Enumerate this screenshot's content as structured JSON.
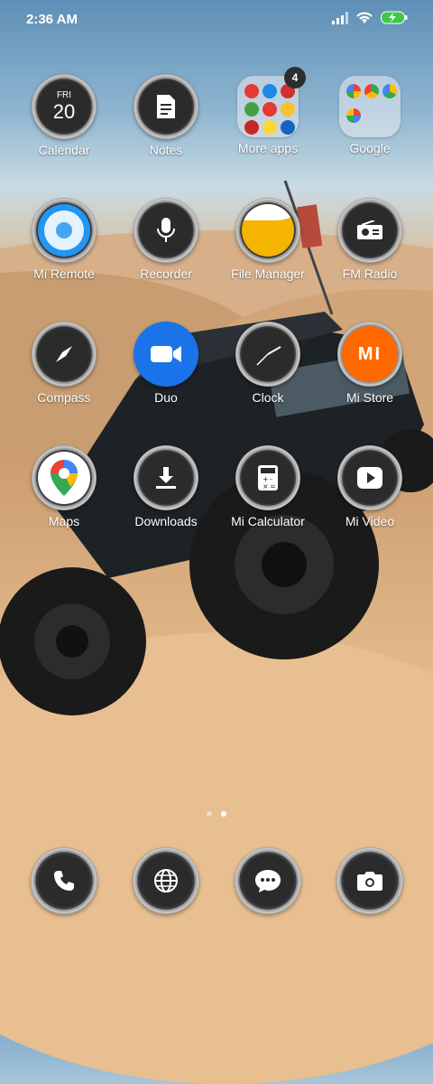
{
  "status": {
    "time": "2:36 AM"
  },
  "rows": [
    [
      {
        "label": "Calendar",
        "day": "FRI",
        "date": "20",
        "icon": "calendar-icon"
      },
      {
        "label": "Notes",
        "icon": "notes-icon"
      },
      {
        "label": "More apps",
        "badge": "4",
        "icon": "folder-icon"
      },
      {
        "label": "Google",
        "icon": "folder-icon"
      }
    ],
    [
      {
        "label": "Mi Remote",
        "icon": "remote-icon"
      },
      {
        "label": "Recorder",
        "icon": "microphone-icon"
      },
      {
        "label": "File Manager",
        "icon": "folder-yellow-icon"
      },
      {
        "label": "FM Radio",
        "icon": "radio-icon"
      }
    ],
    [
      {
        "label": "Compass",
        "icon": "compass-icon"
      },
      {
        "label": "Duo",
        "icon": "video-camera-icon"
      },
      {
        "label": "Clock",
        "icon": "clock-icon"
      },
      {
        "label": "Mi Store",
        "logo": "MI",
        "icon": "mi-logo-icon"
      }
    ],
    [
      {
        "label": "Maps",
        "icon": "map-pin-icon"
      },
      {
        "label": "Downloads",
        "icon": "download-icon"
      },
      {
        "label": "Mi Calculator",
        "icon": "calculator-icon"
      },
      {
        "label": "Mi Video",
        "icon": "play-icon"
      }
    ]
  ],
  "dock": [
    {
      "name": "phone",
      "icon": "phone-icon"
    },
    {
      "name": "browser",
      "icon": "globe-icon"
    },
    {
      "name": "messages",
      "icon": "chat-icon"
    },
    {
      "name": "camera",
      "icon": "camera-icon"
    }
  ],
  "colors": {
    "accent_orange": "#ff6900",
    "duo_blue": "#1a73e8",
    "file_yellow": "#f4b400"
  }
}
